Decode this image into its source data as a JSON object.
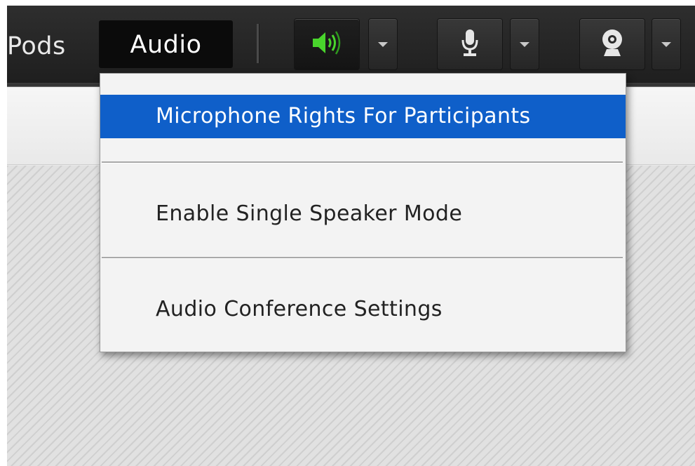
{
  "menubar": {
    "pods_label": "Pods",
    "audio_label": "Audio"
  },
  "toolbar": {
    "speaker_button": {
      "icon": "speaker-icon",
      "active": true,
      "color": "#48d22b"
    },
    "microphone_button": {
      "icon": "microphone-icon"
    },
    "camera_button": {
      "icon": "webcam-icon"
    }
  },
  "audio_menu": {
    "items": [
      {
        "label": "Microphone Rights For Participants",
        "highlighted": true
      },
      {
        "label": "Enable Single Speaker Mode",
        "highlighted": false
      },
      {
        "label": "Audio Conference Settings",
        "highlighted": false
      }
    ],
    "highlight_color": "#0f5fc9"
  }
}
